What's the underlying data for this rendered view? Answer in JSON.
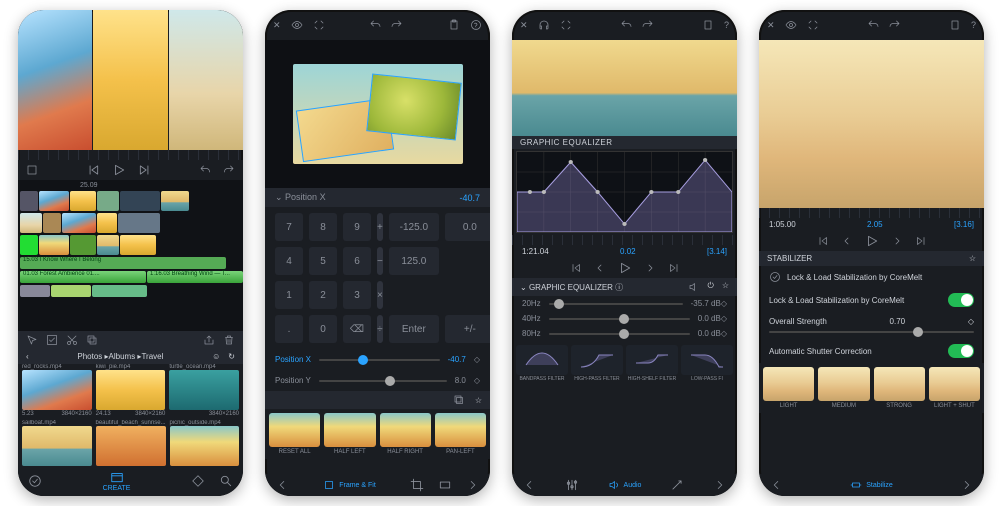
{
  "screen1": {
    "markers": "25.09",
    "tracks": {
      "audio1": "15.03  I Know Where I Belong",
      "audio2": "01.03  Forest Ambience 01....",
      "audio3": "1:16.03  Breathing Wind — T..."
    },
    "browser_head": "Photos ▸Albums ▸Travel",
    "thumbs": [
      {
        "name": "red_rocks.mp4",
        "dur": "5.23",
        "res": "3840×2160"
      },
      {
        "name": "kiwi_pie.mp4",
        "dur": "24.13",
        "res": "3840×2160"
      },
      {
        "name": "turtle_ocean.mp4",
        "dur": "",
        "res": "3840×2160"
      },
      {
        "name": "sailboat.mp4",
        "dur": "",
        "res": ""
      },
      {
        "name": "beautiful_beach_sunrise...",
        "dur": "",
        "res": ""
      },
      {
        "name": "picnic_outside.mp4",
        "dur": "",
        "res": ""
      }
    ],
    "bottom_center": "CREATE"
  },
  "screen2": {
    "param_name": "Position X",
    "param_value": "-40.7",
    "numpad": {
      "vals1": "-125.0",
      "zero": "0.0",
      "vals2": "125.0",
      "enter": "Enter",
      "pm": "+/-"
    },
    "slider1_label": "Position X",
    "slider1_value": "-40.7",
    "slider2_label": "Position Y",
    "slider2_value": "8.0",
    "presets": [
      "RESET ALL",
      "HALF LEFT",
      "HALF RIGHT",
      "PAN-LEFT"
    ],
    "bottom_center": "Frame & Fit"
  },
  "screen3": {
    "eq_title": "GRAPHIC EQUALIZER",
    "time_left": "1:21.04",
    "time_mid": "0.02",
    "time_right": "[3.14]",
    "section": "GRAPHIC EQUALIZER ⓘ",
    "eqbands": [
      {
        "hz": "20Hz",
        "db": "-35.7 dB"
      },
      {
        "hz": "40Hz",
        "db": "0.0 dB"
      },
      {
        "hz": "80Hz",
        "db": "0.0 dB"
      }
    ],
    "filters": [
      "BANDPASS FILTER",
      "HIGH-PASS FILTER",
      "HIGH-SHELF FILTER",
      "LOW-PASS FI"
    ],
    "bottom_center": "Audio"
  },
  "screen4": {
    "time_left": "1:05.00",
    "time_mid": "2.05",
    "time_right": "[3.16]",
    "section": "STABILIZER",
    "rows": {
      "brand": "Lock & Load Stabilization by CoreMelt",
      "brand2": "Lock & Load Stabilization by CoreMelt",
      "strength_label": "Overall Strength",
      "strength_val": "0.70",
      "auto": "Automatic Shutter Correction"
    },
    "presets": [
      "LIGHT",
      "MEDIUM",
      "STRONG",
      "LIGHT + SHUT"
    ],
    "bottom_center": "Stabilize"
  }
}
